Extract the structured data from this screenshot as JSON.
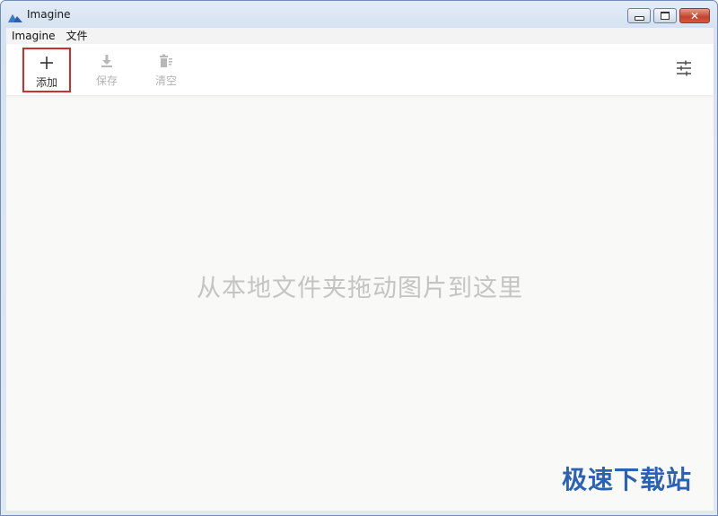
{
  "window": {
    "title": "Imagine",
    "controls": {
      "minimize": "minimize",
      "maximize": "maximize",
      "close": "✕"
    }
  },
  "menubar": {
    "items": [
      {
        "label": "Imagine"
      },
      {
        "label": "文件"
      }
    ]
  },
  "toolbar": {
    "add_label": "添加",
    "save_label": "保存",
    "clear_label": "清空",
    "icons": {
      "add": "plus-icon",
      "save": "download-icon",
      "clear": "trash-icon",
      "settings": "sliders-icon"
    }
  },
  "main": {
    "drop_hint": "从本地文件夹拖动图片到这里"
  },
  "watermark": {
    "text": "极速下载站"
  },
  "colors": {
    "highlight_border": "#d22c2c",
    "watermark": "#2c62b3",
    "disabled_text": "#b3b3b3",
    "hint_text": "#c4c4c4"
  }
}
